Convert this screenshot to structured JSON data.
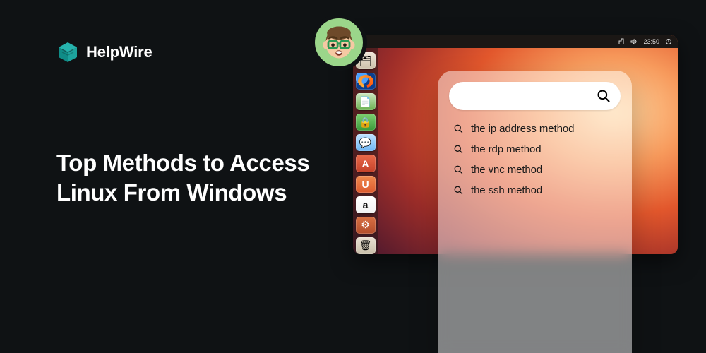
{
  "brand": {
    "name": "HelpWire"
  },
  "headline": "Top Methods to Access Linux From Windows",
  "topbar": {
    "clock": "23:50"
  },
  "launcher": {
    "items": [
      {
        "name": "files",
        "glyph": "🗂"
      },
      {
        "name": "firefox",
        "glyph": ""
      },
      {
        "name": "libre",
        "glyph": "📄"
      },
      {
        "name": "lock",
        "glyph": "🔒"
      },
      {
        "name": "empathy",
        "glyph": "💬"
      },
      {
        "name": "fonts",
        "glyph": "A"
      },
      {
        "name": "uone",
        "glyph": "U"
      },
      {
        "name": "amazon",
        "glyph": "a"
      },
      {
        "name": "sett",
        "glyph": "⚙"
      },
      {
        "name": "trash",
        "glyph": "🗑"
      }
    ]
  },
  "search": {
    "value": ""
  },
  "suggestions": [
    "the ip address method",
    "the rdp method",
    "the vnc method",
    "the ssh method"
  ],
  "colors": {
    "teal": "#26b3ad"
  }
}
